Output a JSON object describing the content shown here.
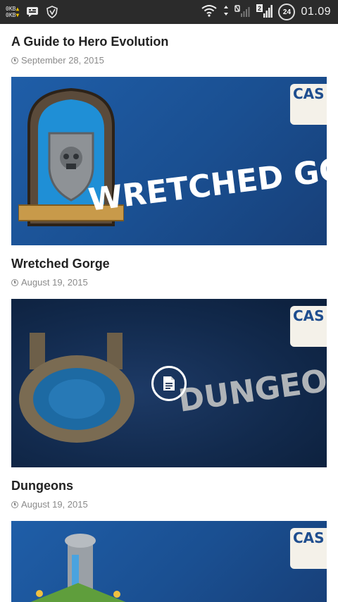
{
  "status_bar": {
    "net_up": "0KB",
    "net_down": "0KB",
    "up_arrow": "▲",
    "down_arrow": "▼",
    "notifications": [
      "chat-icon",
      "shield-icon"
    ],
    "right_icons": [
      "wifi-icon",
      "data-arrows-icon",
      "no-sim-signal-icon",
      "sim2-signal-icon"
    ],
    "badge": "24",
    "time": "01.09"
  },
  "posts": [
    {
      "title": "A Guide to Hero Evolution",
      "date": "September 28, 2015"
    },
    {
      "title": "Wretched Gorge",
      "date": "August 19, 2015",
      "banner_text": "WRETCHED GORG",
      "logo_text": "CAS CLA"
    },
    {
      "title": "Dungeons",
      "date": "August 19, 2015",
      "banner_text": "DUNGEONS",
      "logo_text": "CAS CLA",
      "overlay_icon": "document-icon"
    },
    {
      "title": "",
      "date": "",
      "logo_text": "CAS CLA"
    }
  ],
  "colors": {
    "status_bar": "#2b2b2b",
    "banner_blue": "#1f5ea8",
    "banner_dark": "#0c1f3b",
    "text": "#222222",
    "meta": "#8a8a8a"
  }
}
